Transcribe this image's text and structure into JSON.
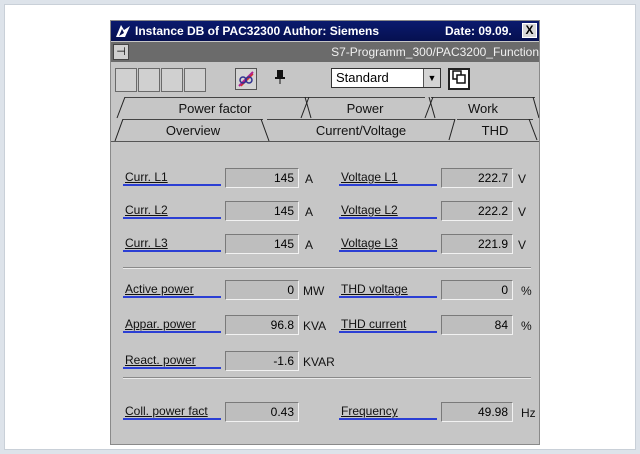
{
  "window": {
    "title": "Instance DB of PAC32300 Author: Siemens",
    "date": "Date: 09.09.",
    "close": "X",
    "path": "S7-Programm_300/PAC3200_Function"
  },
  "toolbar": {
    "view_select": "Standard"
  },
  "tabs": {
    "row_back": [
      "Power factor",
      "Power",
      "Work"
    ],
    "row_front": [
      "Overview",
      "Current/Voltage",
      "THD"
    ]
  },
  "currents": [
    {
      "label": "Curr. L1",
      "value": "145",
      "unit": "A"
    },
    {
      "label": "Curr. L2",
      "value": "145",
      "unit": "A"
    },
    {
      "label": "Curr. L3",
      "value": "145",
      "unit": "A"
    }
  ],
  "voltages": [
    {
      "label": "Voltage L1",
      "value": "222.7",
      "unit": "V"
    },
    {
      "label": "Voltage L2",
      "value": "222.2",
      "unit": "V"
    },
    {
      "label": "Voltage L3",
      "value": "221.9",
      "unit": "V"
    }
  ],
  "power": [
    {
      "label": "Active power",
      "value": "0",
      "unit": "MW"
    },
    {
      "label": "Appar. power",
      "value": "96.8",
      "unit": "KVA"
    },
    {
      "label": "React. power",
      "value": "-1.6",
      "unit": "KVAR"
    }
  ],
  "thd": [
    {
      "label": "THD voltage",
      "value": "0",
      "unit": "%"
    },
    {
      "label": "THD current",
      "value": "84",
      "unit": "%"
    }
  ],
  "bottom": {
    "pf_label": "Coll. power fact",
    "pf_value": "0.43",
    "freq_label": "Frequency",
    "freq_value": "49.98",
    "freq_unit": "Hz"
  }
}
